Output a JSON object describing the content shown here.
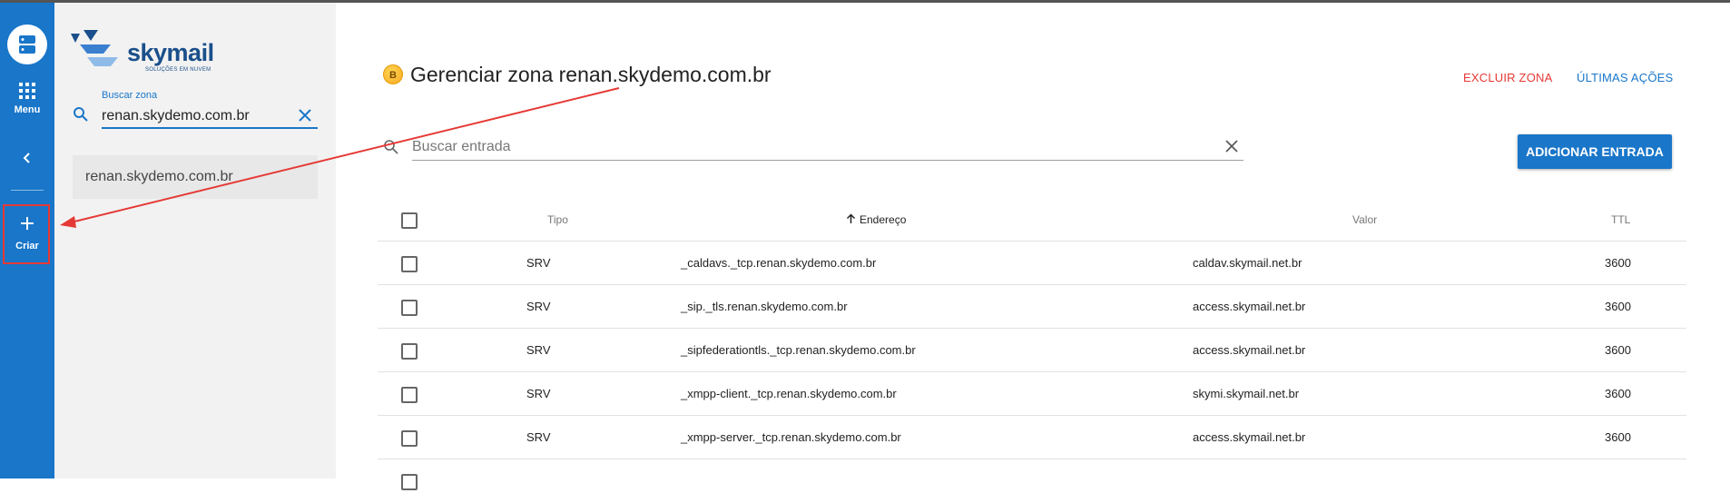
{
  "rail": {
    "menu_label": "Menu",
    "criar_label": "Criar"
  },
  "brand": {
    "name": "skymail",
    "tagline": "SOLUÇÕES EM NUVEM"
  },
  "zone_panel": {
    "search_label": "Buscar zona",
    "search_value": "renan.skydemo.com.br",
    "zones": [
      "renan.skydemo.com.br"
    ]
  },
  "main": {
    "badge": "B",
    "title": "Gerenciar zona renan.skydemo.com.br",
    "excluir_label": "EXCLUIR ZONA",
    "ultimas_label": "ÚLTIMAS AÇÕES",
    "entry_search_placeholder": "Buscar entrada",
    "add_button_label": "ADICIONAR ENTRADA"
  },
  "table": {
    "headers": {
      "tipo": "Tipo",
      "endereco": "Endereço",
      "valor": "Valor",
      "ttl": "TTL"
    },
    "sort_icon": "arrow-up-icon",
    "rows": [
      {
        "tipo": "SRV",
        "endereco": "_caldavs._tcp.renan.skydemo.com.br",
        "valor": "caldav.skymail.net.br",
        "ttl": "3600"
      },
      {
        "tipo": "SRV",
        "endereco": "_sip._tls.renan.skydemo.com.br",
        "valor": "access.skymail.net.br",
        "ttl": "3600"
      },
      {
        "tipo": "SRV",
        "endereco": "_sipfederationtls._tcp.renan.skydemo.com.br",
        "valor": "access.skymail.net.br",
        "ttl": "3600"
      },
      {
        "tipo": "SRV",
        "endereco": "_xmpp-client._tcp.renan.skydemo.com.br",
        "valor": "skymi.skymail.net.br",
        "ttl": "3600"
      },
      {
        "tipo": "SRV",
        "endereco": "_xmpp-server._tcp.renan.skydemo.com.br",
        "valor": "access.skymail.net.br",
        "ttl": "3600"
      }
    ]
  },
  "colors": {
    "primary": "#1976c9",
    "danger": "#e53935",
    "annotation": "#e53935"
  }
}
